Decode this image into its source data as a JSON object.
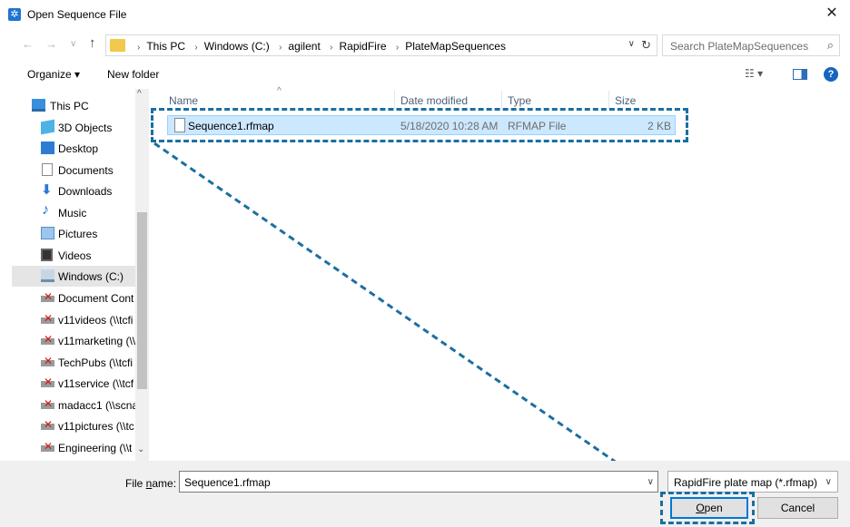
{
  "window": {
    "title": "Open Sequence File",
    "close_glyph": "✕",
    "app_icon": "gear-snowflake-icon"
  },
  "nav": {
    "back_glyph": "←",
    "forward_glyph": "→",
    "recent_glyph": "∨",
    "up_glyph": "↑",
    "breadcrumb": [
      "This PC",
      "Windows (C:)",
      "agilent",
      "RapidFire",
      "PlateMapSequences"
    ],
    "separator_glyph": "›",
    "dropdown_glyph": "∨",
    "refresh_glyph": "↻",
    "search_placeholder": "Search PlateMapSequences",
    "search_glyph": "⌕"
  },
  "toolbar": {
    "organize_label": "Organize ▾",
    "new_folder_label": "New folder",
    "view_glyph": "☷ ▾",
    "help_glyph": "?"
  },
  "sidebar": {
    "items": [
      {
        "label": "This PC",
        "icon": "this-pc-icon",
        "level": 0
      },
      {
        "label": "3D Objects",
        "icon": "3d-objects-icon",
        "level": 1
      },
      {
        "label": "Desktop",
        "icon": "desktop-icon",
        "level": 1
      },
      {
        "label": "Documents",
        "icon": "documents-icon",
        "level": 1
      },
      {
        "label": "Downloads",
        "icon": "downloads-icon",
        "level": 1
      },
      {
        "label": "Music",
        "icon": "music-icon",
        "level": 1
      },
      {
        "label": "Pictures",
        "icon": "pictures-icon",
        "level": 1
      },
      {
        "label": "Videos",
        "icon": "videos-icon",
        "level": 1
      },
      {
        "label": "Windows (C:)",
        "icon": "drive-icon",
        "level": 1,
        "selected": true
      },
      {
        "label": "Document Cont",
        "icon": "network-drive-disconnected-icon",
        "level": 1
      },
      {
        "label": "v11videos (\\\\tcfi",
        "icon": "network-drive-disconnected-icon",
        "level": 1
      },
      {
        "label": "v11marketing (\\\\",
        "icon": "network-drive-disconnected-icon",
        "level": 1
      },
      {
        "label": "TechPubs (\\\\tcfi",
        "icon": "network-drive-disconnected-icon",
        "level": 1
      },
      {
        "label": "v11service (\\\\tcf",
        "icon": "network-drive-disconnected-icon",
        "level": 1
      },
      {
        "label": "madacc1 (\\\\scna",
        "icon": "network-drive-disconnected-icon",
        "level": 1
      },
      {
        "label": "v11pictures (\\\\tc",
        "icon": "network-drive-disconnected-icon",
        "level": 1
      },
      {
        "label": "Engineering (\\\\t",
        "icon": "network-drive-disconnected-icon",
        "level": 1
      }
    ],
    "scroll_up_glyph": "^",
    "scroll_down_glyph": "⌄"
  },
  "file_list": {
    "columns": [
      "Name",
      "Date modified",
      "Type",
      "Size"
    ],
    "sort_glyph": "^",
    "rows": [
      {
        "name": "Sequence1.rfmap",
        "date_modified": "5/18/2020 10:28 AM",
        "type": "RFMAP File",
        "size": "2 KB",
        "selected": true
      }
    ]
  },
  "bottom": {
    "file_name_label_pre": "File ",
    "file_name_label_accel": "n",
    "file_name_label_post": "ame:",
    "file_name_value": "Sequence1.rfmap",
    "file_name_dropdown_glyph": "∨",
    "filter_value": "RapidFire plate map (*.rfmap)",
    "filter_dropdown_glyph": "∨",
    "open_label_accel": "O",
    "open_label_rest": "pen",
    "cancel_label": "Cancel"
  },
  "annotation": {
    "callout_color": "#1a6fa0"
  }
}
